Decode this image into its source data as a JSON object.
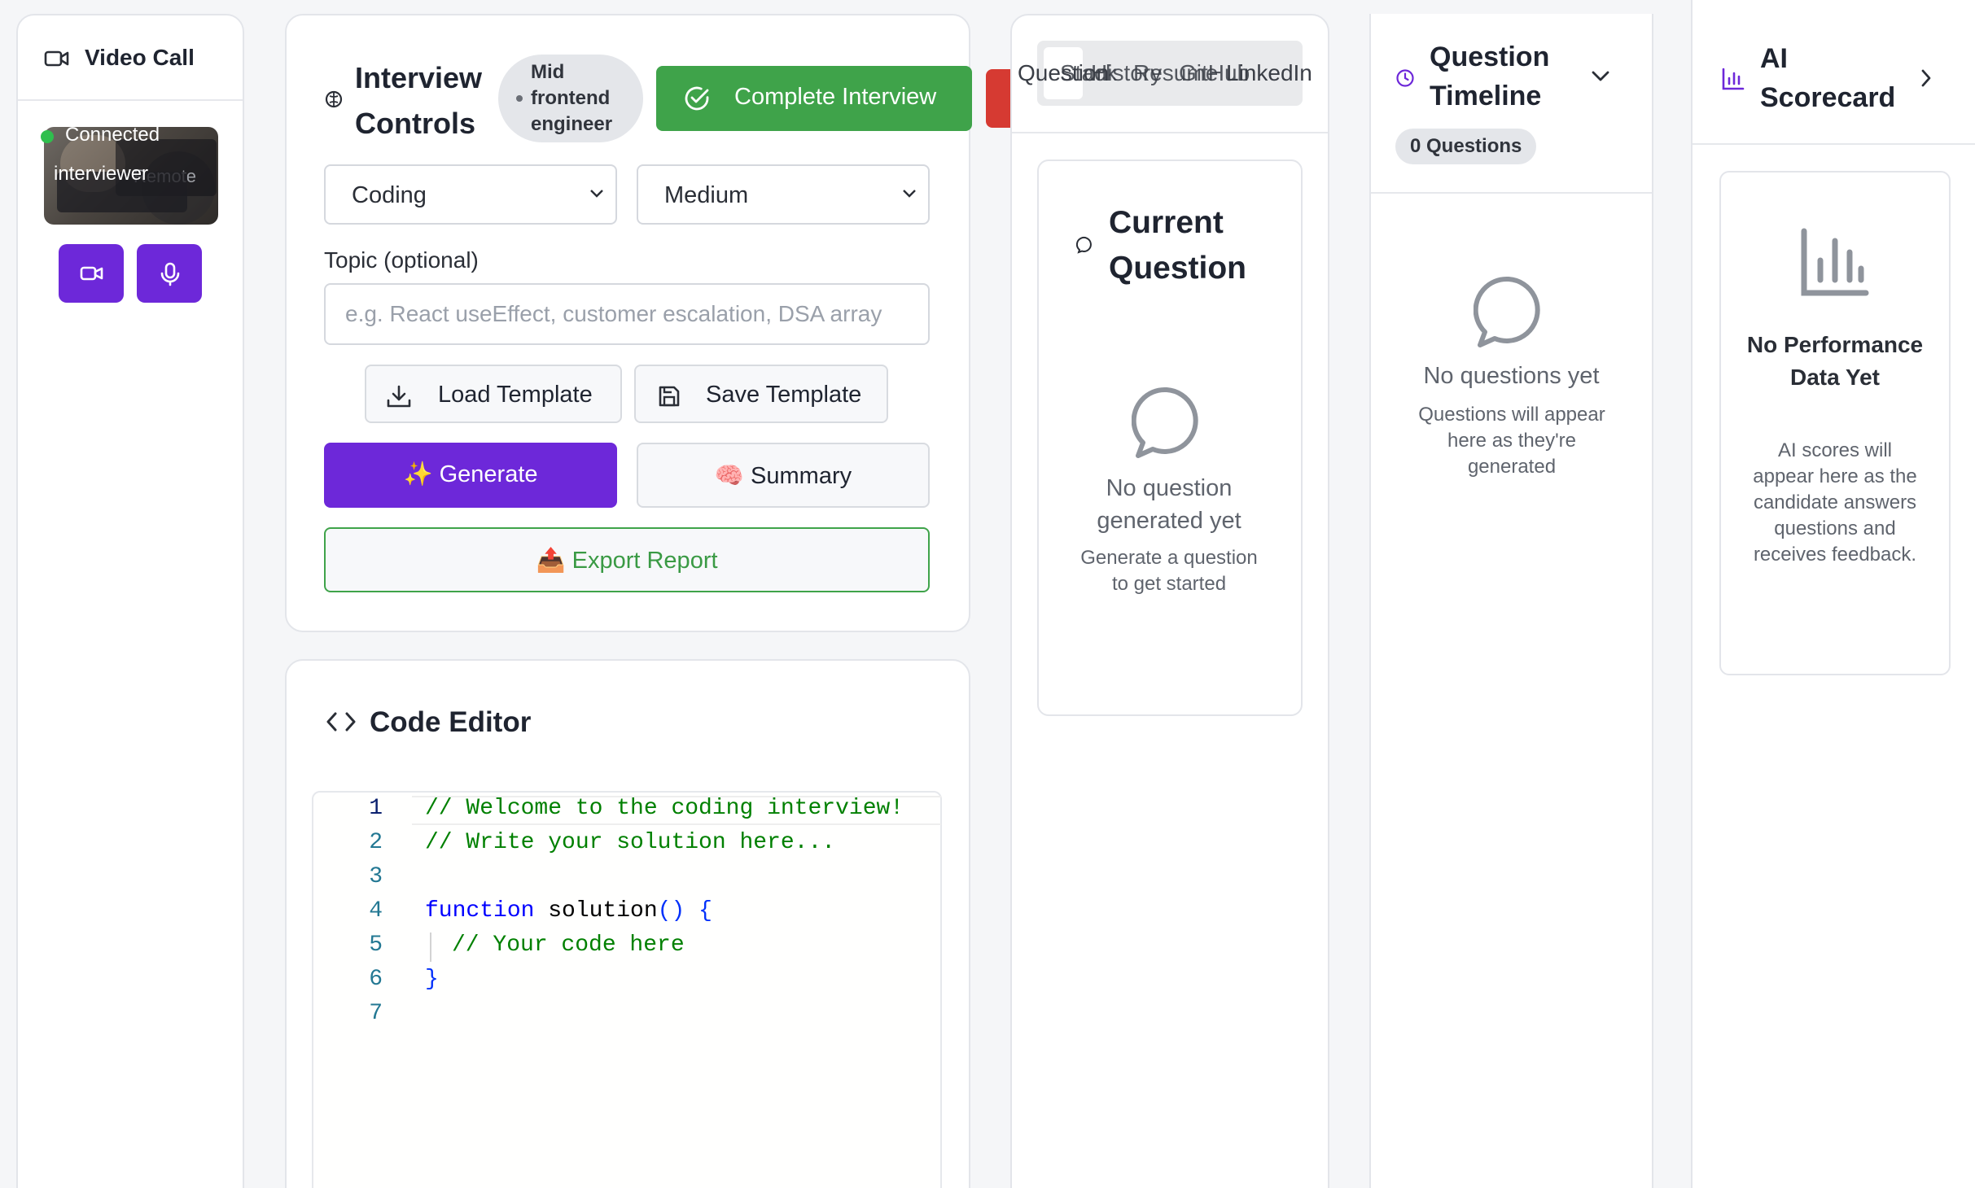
{
  "video": {
    "title": "Video Call",
    "status": "Connected",
    "remote_label": "Remote",
    "participant": "interviewer"
  },
  "controls": {
    "title": "Interview Controls",
    "level_badge": "Mid frontend engineer",
    "complete_label": "Complete Interview",
    "type_value": "Coding",
    "difficulty_value": "Medium",
    "topic_label": "Topic (optional)",
    "topic_placeholder": "e.g. React useEffect, customer escalation, DSA array",
    "load_template": "Load Template",
    "save_template": "Save Template",
    "generate": "✨ Generate",
    "summary": "🧠 Summary",
    "export": "📤 Export Report"
  },
  "editor": {
    "title": "Code Editor",
    "line_numbers": [
      "1",
      "2",
      "3",
      "4",
      "5",
      "6",
      "7"
    ],
    "lines": {
      "l1": "// Welcome to the coding interview!",
      "l2": "// Write your solution here...",
      "l4_kw": "function",
      "l4_name": " solution",
      "l4_rest": "() {",
      "l5": "// Your code here",
      "l6": "}"
    }
  },
  "question_panel": {
    "tabs": [
      "Question",
      "Stack",
      "History",
      "Resume",
      "GitHub",
      "LinkedIn"
    ],
    "current_title": "Current Question",
    "empty_title": "No question generated yet",
    "empty_subtitle": "Generate a question to get started"
  },
  "timeline": {
    "title": "Question Timeline",
    "count": "0 Questions",
    "empty_title": "No questions yet",
    "empty_subtitle": "Questions will appear here as they're generated"
  },
  "scorecard": {
    "title": "AI Scorecard",
    "empty_title": "No Performance Data Yet",
    "empty_subtitle": "AI scores will appear here as the candidate answers questions and receives feedback."
  },
  "colors": {
    "accent": "#6d28d9",
    "success": "#3fa34a",
    "danger": "#d63a32"
  }
}
